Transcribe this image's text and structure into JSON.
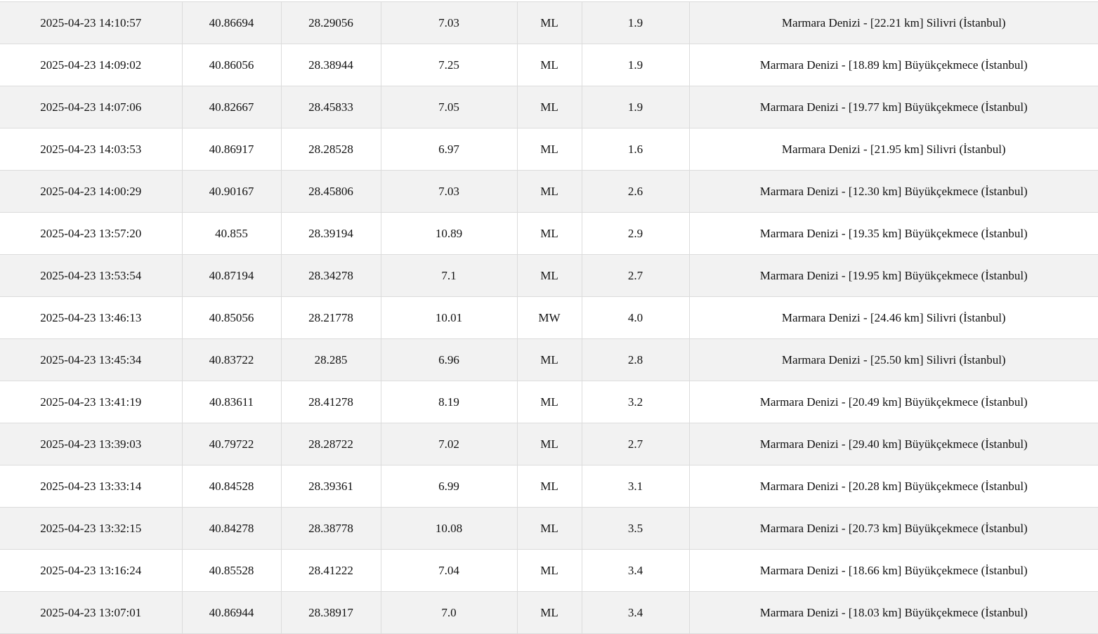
{
  "rows": [
    {
      "date": "2025-04-23 14:10:57",
      "lat": "40.86694",
      "lon": "28.29056",
      "depth": "7.03",
      "type": "ML",
      "mag": "1.9",
      "location": "Marmara Denizi - [22.21 km] Silivri (İstanbul)"
    },
    {
      "date": "2025-04-23 14:09:02",
      "lat": "40.86056",
      "lon": "28.38944",
      "depth": "7.25",
      "type": "ML",
      "mag": "1.9",
      "location": "Marmara Denizi - [18.89 km] Büyükçekmece (İstanbul)"
    },
    {
      "date": "2025-04-23 14:07:06",
      "lat": "40.82667",
      "lon": "28.45833",
      "depth": "7.05",
      "type": "ML",
      "mag": "1.9",
      "location": "Marmara Denizi - [19.77 km] Büyükçekmece (İstanbul)"
    },
    {
      "date": "2025-04-23 14:03:53",
      "lat": "40.86917",
      "lon": "28.28528",
      "depth": "6.97",
      "type": "ML",
      "mag": "1.6",
      "location": "Marmara Denizi - [21.95 km] Silivri (İstanbul)"
    },
    {
      "date": "2025-04-23 14:00:29",
      "lat": "40.90167",
      "lon": "28.45806",
      "depth": "7.03",
      "type": "ML",
      "mag": "2.6",
      "location": "Marmara Denizi - [12.30 km] Büyükçekmece (İstanbul)"
    },
    {
      "date": "2025-04-23 13:57:20",
      "lat": "40.855",
      "lon": "28.39194",
      "depth": "10.89",
      "type": "ML",
      "mag": "2.9",
      "location": "Marmara Denizi - [19.35 km] Büyükçekmece (İstanbul)"
    },
    {
      "date": "2025-04-23 13:53:54",
      "lat": "40.87194",
      "lon": "28.34278",
      "depth": "7.1",
      "type": "ML",
      "mag": "2.7",
      "location": "Marmara Denizi - [19.95 km] Büyükçekmece (İstanbul)"
    },
    {
      "date": "2025-04-23 13:46:13",
      "lat": "40.85056",
      "lon": "28.21778",
      "depth": "10.01",
      "type": "MW",
      "mag": "4.0",
      "location": "Marmara Denizi - [24.46 km] Silivri (İstanbul)"
    },
    {
      "date": "2025-04-23 13:45:34",
      "lat": "40.83722",
      "lon": "28.285",
      "depth": "6.96",
      "type": "ML",
      "mag": "2.8",
      "location": "Marmara Denizi - [25.50 km] Silivri (İstanbul)"
    },
    {
      "date": "2025-04-23 13:41:19",
      "lat": "40.83611",
      "lon": "28.41278",
      "depth": "8.19",
      "type": "ML",
      "mag": "3.2",
      "location": "Marmara Denizi - [20.49 km] Büyükçekmece (İstanbul)"
    },
    {
      "date": "2025-04-23 13:39:03",
      "lat": "40.79722",
      "lon": "28.28722",
      "depth": "7.02",
      "type": "ML",
      "mag": "2.7",
      "location": "Marmara Denizi - [29.40 km] Büyükçekmece (İstanbul)"
    },
    {
      "date": "2025-04-23 13:33:14",
      "lat": "40.84528",
      "lon": "28.39361",
      "depth": "6.99",
      "type": "ML",
      "mag": "3.1",
      "location": "Marmara Denizi - [20.28 km] Büyükçekmece (İstanbul)"
    },
    {
      "date": "2025-04-23 13:32:15",
      "lat": "40.84278",
      "lon": "28.38778",
      "depth": "10.08",
      "type": "ML",
      "mag": "3.5",
      "location": "Marmara Denizi - [20.73 km] Büyükçekmece (İstanbul)"
    },
    {
      "date": "2025-04-23 13:16:24",
      "lat": "40.85528",
      "lon": "28.41222",
      "depth": "7.04",
      "type": "ML",
      "mag": "3.4",
      "location": "Marmara Denizi - [18.66 km] Büyükçekmece (İstanbul)"
    },
    {
      "date": "2025-04-23 13:07:01",
      "lat": "40.86944",
      "lon": "28.38917",
      "depth": "7.0",
      "type": "ML",
      "mag": "3.4",
      "location": "Marmara Denizi - [18.03 km] Büyükçekmece (İstanbul)"
    }
  ]
}
